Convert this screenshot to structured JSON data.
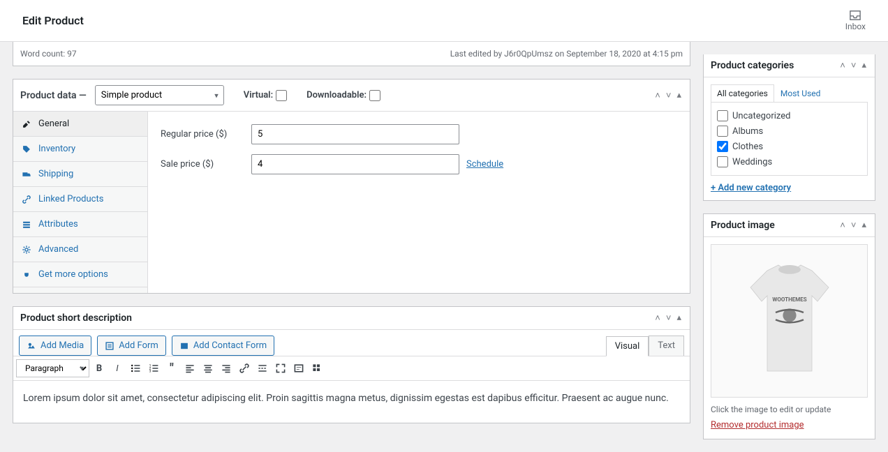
{
  "header": {
    "title": "Edit Product",
    "inbox": "Inbox"
  },
  "wordcount": {
    "label": "Word count: 97",
    "lastedit": "Last edited by J6r0QpUmsz on September 18, 2020 at 4:15 pm"
  },
  "pd": {
    "title": "Product data —",
    "type": "Simple product",
    "virtual_label": "Virtual:",
    "downloadable_label": "Downloadable:",
    "tabs": {
      "general": "General",
      "inventory": "Inventory",
      "shipping": "Shipping",
      "linked": "Linked Products",
      "attributes": "Attributes",
      "advanced": "Advanced",
      "more": "Get more options"
    },
    "regular_label": "Regular price ($)",
    "regular_value": "5",
    "sale_label": "Sale price ($)",
    "sale_value": "4",
    "schedule": "Schedule"
  },
  "shortdesc": {
    "title": "Product short description",
    "add_media": "Add Media",
    "add_form": "Add Form",
    "add_contact": "Add Contact Form",
    "visual": "Visual",
    "text": "Text",
    "paragraph": "Paragraph",
    "content": "Lorem ipsum dolor sit amet, consectetur adipiscing elit. Proin sagittis magna metus, dignissim egestas est dapibus efficitur. Praesent ac augue nunc."
  },
  "categories": {
    "title": "Product categories",
    "all": "All categories",
    "most": "Most Used",
    "items": {
      "uncat": "Uncategorized",
      "albums": "Albums",
      "clothes": "Clothes",
      "weddings": "Weddings"
    },
    "add": "+ Add new category"
  },
  "image": {
    "title": "Product image",
    "hint": "Click the image to edit or update",
    "remove": "Remove product image"
  }
}
